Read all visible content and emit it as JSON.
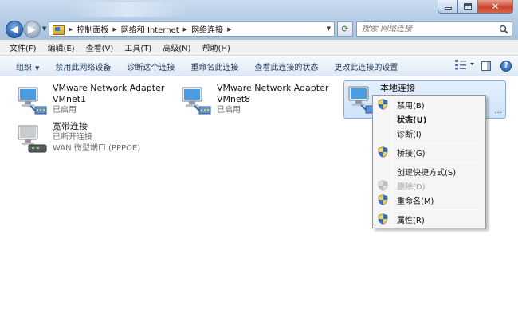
{
  "nav": {
    "breadcrumbs": [
      "控制面板",
      "网络和 Internet",
      "网络连接"
    ],
    "search_placeholder": "搜索 网络连接"
  },
  "menubar": {
    "items": [
      "文件(F)",
      "编辑(E)",
      "查看(V)",
      "工具(T)",
      "高级(N)",
      "帮助(H)"
    ]
  },
  "toolbar": {
    "organize": "组织",
    "disable": "禁用此网络设备",
    "diagnose": "诊断这个连接",
    "rename": "重命名此连接",
    "view_status": "查看此连接的状态",
    "change_settings": "更改此连接的设置"
  },
  "connections": [
    {
      "name": "VMware Network Adapter",
      "device": "VMnet1",
      "status": "已启用"
    },
    {
      "name": "VMware Network Adapter",
      "device": "VMnet8",
      "status": "已启用"
    },
    {
      "name": "本地连接",
      "selected": true,
      "truncated": "..."
    },
    {
      "name": "宽带连接",
      "status": "已断开连接",
      "device": "WAN 微型端口 (PPPOE)"
    }
  ],
  "context_menu": {
    "items": [
      {
        "label": "禁用(B)",
        "icon": "shield-icon"
      },
      {
        "label": "状态(U)",
        "bold": true
      },
      {
        "label": "诊断(I)"
      },
      {
        "label": "桥接(G)",
        "icon": "shield-icon"
      },
      {
        "label": "创建快捷方式(S)"
      },
      {
        "label": "删除(D)",
        "icon": "shield-icon",
        "disabled": true
      },
      {
        "label": "重命名(M)",
        "icon": "shield-icon"
      },
      {
        "label": "属性(R)",
        "icon": "shield-icon"
      }
    ]
  },
  "colors": {
    "titlebar": "#c9dcef",
    "selection": "#cfe3fb",
    "close_button": "#c8452c",
    "command_text": "#1e395b"
  }
}
